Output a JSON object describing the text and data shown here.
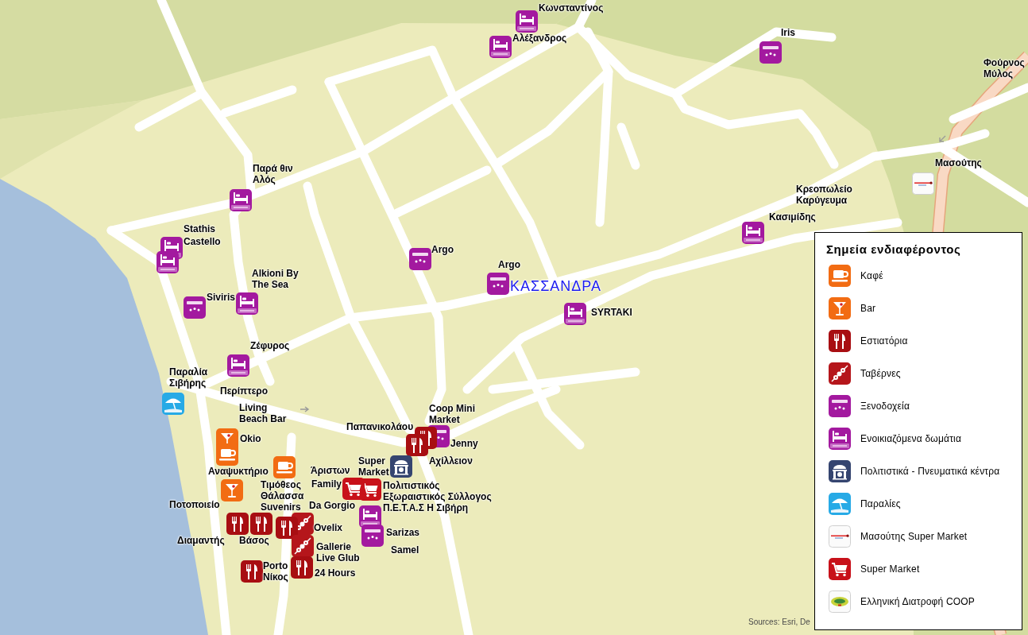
{
  "map": {
    "place_label": "ΚΑΣΣΑΝΔΡΑ",
    "markers": [
      {
        "kind": "rooms"
      },
      {
        "kind": "rooms"
      },
      {
        "kind": "hotel"
      },
      {
        "kind": "rooms"
      },
      {
        "kind": "rooms"
      },
      {
        "kind": "masoutis"
      },
      {
        "kind": "rooms"
      },
      {
        "kind": "rooms"
      },
      {
        "kind": "hotel"
      },
      {
        "kind": "hotel"
      },
      {
        "kind": "rooms"
      },
      {
        "kind": "hotel"
      },
      {
        "kind": "rooms"
      },
      {
        "kind": "rooms"
      },
      {
        "kind": "beach"
      },
      {
        "kind": "hotel"
      },
      {
        "kind": "restaurant"
      },
      {
        "kind": "restaurant"
      },
      {
        "kind": "bar"
      },
      {
        "kind": "cafe"
      },
      {
        "kind": "supermarket"
      },
      {
        "kind": "cultural"
      },
      {
        "kind": "supermarket"
      },
      {
        "kind": "cafe"
      },
      {
        "kind": "bar"
      },
      {
        "kind": "taverna"
      },
      {
        "kind": "rooms"
      },
      {
        "kind": "hotel"
      },
      {
        "kind": "restaurant"
      },
      {
        "kind": "restaurant"
      },
      {
        "kind": "restaurant"
      },
      {
        "kind": "taverna"
      },
      {
        "kind": "restaurant"
      },
      {
        "kind": "restaurant"
      }
    ],
    "labels": [
      "Κωνσταντίνος",
      "Αλέξανδρος",
      "Iris",
      "Φούρνος\nΜύλος",
      "Παρά θιν\nΑλός",
      "Μασούτης",
      "Κρεοπωλείο\nΚαρύγευμα",
      "Κασιμίδης",
      "Stathis",
      "Castello",
      "Argo",
      "Alkioni By\nThe Sea",
      "Argo",
      "Siviris",
      "SYRTAKI",
      "Ζέφυρος",
      "Παραλία\nΣιβήρης",
      "Περίπτερο",
      "Living\nBeach Bar",
      "Παπανικολάου",
      "Coop Mini\nMarket",
      "Okio",
      "Jenny",
      "Αναψυκτήριο",
      "Άριστων",
      "Super\nMarket",
      "Αχίλλειον",
      "Ποτοποιείο",
      "Τιμόθεος\nΘάλασσα\nSuvenirs",
      "Family",
      "Da Gorgio",
      "Πολιτιστικός\nΕξωραιστικός Σύλλογος\nΠ.Ε.Τ.Α.Σ Η Σιβήρη",
      "Ovelix",
      "Διαμαντής",
      "Βάσος",
      "Sarizas",
      "Porto\nΝίκος",
      "Gallerie\nLive Glub",
      "Samel",
      "24 Hours"
    ],
    "attribution": "Sources: Esri, De"
  },
  "legend": {
    "title": "Σημεία ενδιαφέροντος",
    "items": [
      {
        "kind": "cafe",
        "label": "Καφέ"
      },
      {
        "kind": "bar",
        "label": "Bar"
      },
      {
        "kind": "restaurant",
        "label": "Εστιατόρια"
      },
      {
        "kind": "taverna",
        "label": "Ταβέρνες"
      },
      {
        "kind": "hotel",
        "label": "Ξενοδοχεία"
      },
      {
        "kind": "rooms",
        "label": "Ενοικιαζόμενα δωμάτια"
      },
      {
        "kind": "cultural",
        "label": "Πολιτιστικά - Πνευματικά κέντρα"
      },
      {
        "kind": "beach",
        "label": "Παραλίες"
      },
      {
        "kind": "masoutis",
        "label": "Μασούτης Super Market"
      },
      {
        "kind": "supermarket",
        "label": "Super Market"
      },
      {
        "kind": "coop",
        "label": "Ελληνική Διατροφή COOP"
      }
    ]
  }
}
